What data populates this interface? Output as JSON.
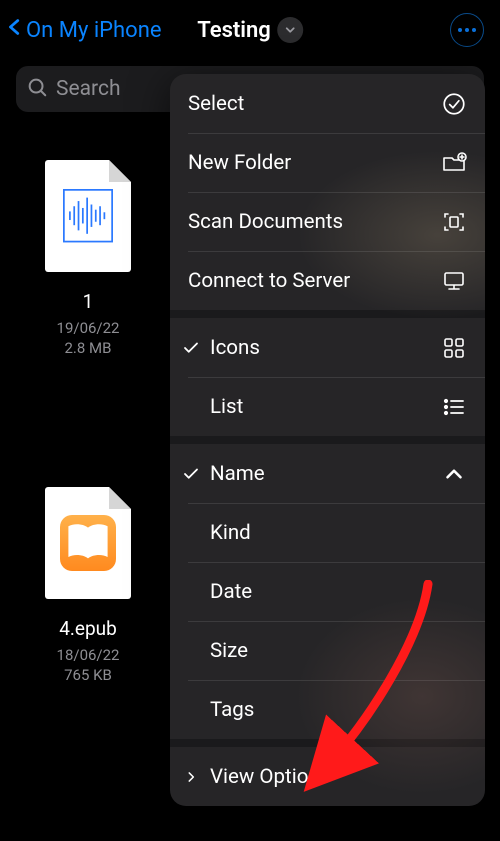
{
  "navbar": {
    "back_label": "On My iPhone",
    "title": "Testing"
  },
  "search": {
    "placeholder": "Search"
  },
  "files": [
    {
      "name": "1",
      "date": "19/06/22",
      "size": "2.8 MB",
      "kind": "audio"
    },
    {
      "name": "4.epub",
      "date": "18/06/22",
      "size": "765 KB",
      "kind": "epub"
    }
  ],
  "menu": {
    "actions": {
      "select": "Select",
      "new_folder": "New Folder",
      "scan_documents": "Scan Documents",
      "connect_to_server": "Connect to Server"
    },
    "view": {
      "icons": "Icons",
      "list": "List",
      "selected_view": "icons"
    },
    "sort": {
      "name": "Name",
      "kind": "Kind",
      "date": "Date",
      "size": "Size",
      "tags": "Tags",
      "selected_sort": "name",
      "direction": "asc"
    },
    "view_options": "View Options"
  },
  "colors": {
    "accent": "#0a84ff"
  }
}
